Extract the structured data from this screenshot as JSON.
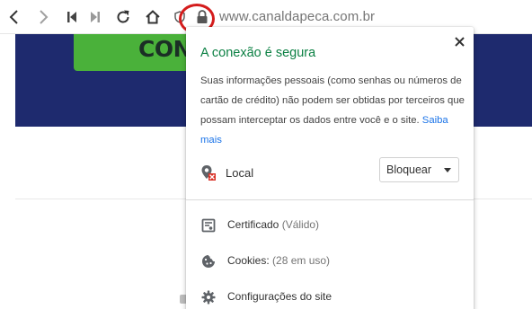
{
  "browser": {
    "url": "www.canaldapeca.com.br"
  },
  "page": {
    "banner_button_text": "CON"
  },
  "popup": {
    "title": "A conexão é segura",
    "description": "Suas informações pessoais (como senhas ou números de cartão de crédito) não podem ser obtidas por terceiros que possam interceptar os dados entre você e o site.",
    "learn_more": "Saiba mais",
    "permission": {
      "label": "Local",
      "value": "Bloquear"
    },
    "items": [
      {
        "label": "Certificado",
        "sub": "(Válido)"
      },
      {
        "label": "Cookies:",
        "sub": "(28 em uso)"
      },
      {
        "label": "Configurações do site",
        "sub": ""
      }
    ]
  }
}
